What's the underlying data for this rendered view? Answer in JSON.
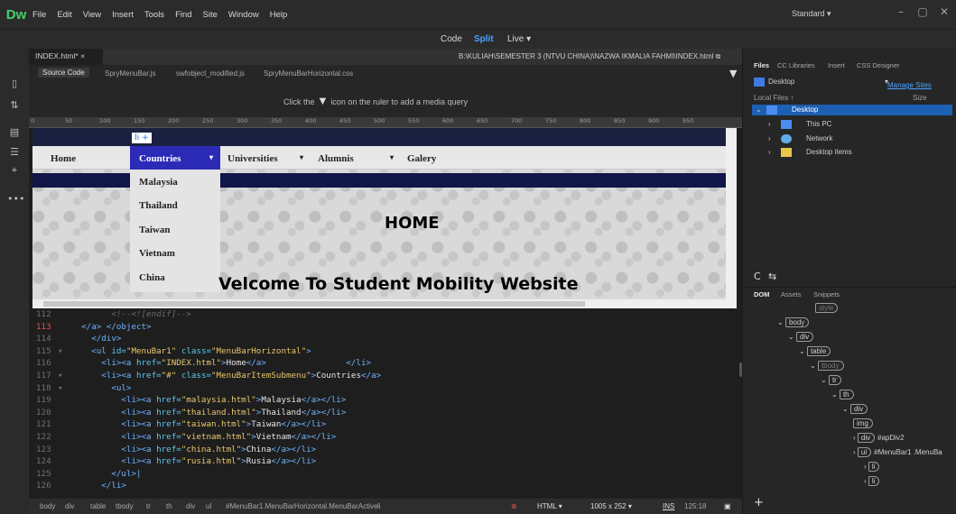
{
  "app": {
    "logo": "Dw",
    "menu": [
      "File",
      "Edit",
      "View",
      "Insert",
      "Tools",
      "Find",
      "Site",
      "Window",
      "Help"
    ],
    "workspace": "Standard",
    "win_buttons": [
      "–",
      "▢",
      "✕"
    ]
  },
  "views": {
    "code": "Code",
    "split": "Split",
    "live": "Live"
  },
  "document": {
    "tab": "INDEX.html*",
    "path": "B:\\KULIAH\\SEMESTER 3 (NTVU CHINA)\\NAZWA IKMALIA FAHMI\\INDEX.html",
    "related_files": [
      "Source Code",
      "SpryMenuBar.js",
      "swfobject_modified.js",
      "SpryMenuBarHorizontal.css"
    ]
  },
  "media_query_hint": {
    "before": "Click the",
    "after": "icon on the ruler to add a media query"
  },
  "ruler_ticks": [
    "0",
    "50",
    "100",
    "150",
    "200",
    "250",
    "300",
    "350",
    "400",
    "450",
    "500",
    "550",
    "600",
    "650",
    "700",
    "750",
    "800",
    "850",
    "900",
    "950"
  ],
  "live": {
    "nav": [
      "Home",
      "Countries",
      "Universities",
      "Alumnis",
      "Galery"
    ],
    "dropdown": [
      "Malaysia",
      "Thailand",
      "Taiwan",
      "Vietnam",
      "China"
    ],
    "heading": "HOME",
    "welcome": "Velcome To Student Mobility Website"
  },
  "code_lines": [
    {
      "n": "112",
      "html": "          <span class='cm'>&lt;!--&lt;![endif]--&gt;</span>"
    },
    {
      "n": "113",
      "err": true,
      "html": "    &lt;/a&gt; &lt;/object&gt;"
    },
    {
      "n": "114",
      "html": "      &lt;/div&gt;"
    },
    {
      "n": "115",
      "fold": true,
      "html": "      &lt;ul <span class='at'>id=</span><span class='st'>\"MenuBar1\"</span> <span class='at'>class=</span><span class='st'>\"MenuBarHorizontal\"</span>&gt;"
    },
    {
      "n": "116",
      "html": "        &lt;li&gt;&lt;a <span class='at'>href=</span><span class='st'>\"INDEX.html\"</span>&gt;<span class='tx'>Home</span>&lt;/a&gt;                &lt;/li&gt;"
    },
    {
      "n": "117",
      "fold": true,
      "html": "        &lt;li&gt;&lt;a <span class='at'>href=</span><span class='st'>\"#\"</span> <span class='at'>class=</span><span class='st'>\"MenuBarItemSubmenu\"</span>&gt;<span class='tx'>Countries</span>&lt;/a&gt;"
    },
    {
      "n": "118",
      "fold": true,
      "html": "          &lt;ul&gt;"
    },
    {
      "n": "119",
      "html": "            &lt;li&gt;&lt;a <span class='at'>href=</span><span class='st'>\"malaysia.html\"</span>&gt;<span class='tx'>Malaysia</span>&lt;/a&gt;&lt;/li&gt;"
    },
    {
      "n": "120",
      "html": "            &lt;li&gt;&lt;a <span class='at'>href=</span><span class='st'>\"thailand.html\"</span>&gt;<span class='tx'>Thailand</span>&lt;/a&gt;&lt;/li&gt;"
    },
    {
      "n": "121",
      "html": "            &lt;li&gt;&lt;a <span class='at'>href=</span><span class='st'>\"taiwan.html\"</span>&gt;<span class='tx'>Taiwan</span>&lt;/a&gt;&lt;/li&gt;"
    },
    {
      "n": "122",
      "html": "            &lt;li&gt;&lt;a <span class='at'>href=</span><span class='st'>\"vietnam.html\"</span>&gt;<span class='tx'>Vietnam</span>&lt;/a&gt;&lt;/li&gt;"
    },
    {
      "n": "123",
      "html": "            &lt;li&gt;&lt;a <span class='at'>href=</span><span class='st'>\"china.html\"</span>&gt;<span class='tx'>China</span>&lt;/a&gt;&lt;/li&gt;"
    },
    {
      "n": "124",
      "html": "            &lt;li&gt;&lt;a <span class='at'>href=</span><span class='st'>\"rusia.html\"</span>&gt;<span class='tx'>Rusia</span>&lt;/a&gt;&lt;/li&gt;"
    },
    {
      "n": "125",
      "html": "          &lt;/ul&gt;|"
    },
    {
      "n": "126",
      "html": "        &lt;/li&gt;"
    }
  ],
  "status": {
    "breadcrumbs": [
      "body",
      "div",
      "table",
      "tbody",
      "tr",
      "th",
      "div",
      "ul",
      "#MenuBar1.MenuBarHorizontal.MenuBarActive",
      "li"
    ],
    "lang": "HTML",
    "size": "1005 x 252",
    "mode": "INS",
    "cursor": "125:18"
  },
  "panels": {
    "files_tabs": [
      "Files",
      "CC Libraries",
      "Insert",
      "CSS Designer"
    ],
    "location": "Desktop",
    "manage_sites": "Manage Sites",
    "local_files": "Local Files ↑",
    "size_col": "Size",
    "tree": [
      "Desktop",
      "This PC",
      "Network",
      "Desktop items"
    ],
    "dom_tabs": [
      "DOM",
      "Assets",
      "Snippets"
    ],
    "dom": [
      {
        "tag": "style",
        "dim": true
      },
      {
        "tag": "body"
      },
      {
        "tag": "div"
      },
      {
        "tag": "table"
      },
      {
        "tag": "tbody",
        "dim": true
      },
      {
        "tag": "tr"
      },
      {
        "tag": "th"
      },
      {
        "tag": "div"
      },
      {
        "tag": "img"
      },
      {
        "tag": "div",
        "label": "#apDiv2"
      },
      {
        "tag": "ul",
        "label": "#MenuBar1 .MenuBa"
      },
      {
        "tag": "li"
      },
      {
        "tag": "li"
      }
    ]
  },
  "colors": {
    "accent": "#4aa3ff",
    "brand": "#46d36b",
    "menu_active": "#2b2bb8"
  }
}
